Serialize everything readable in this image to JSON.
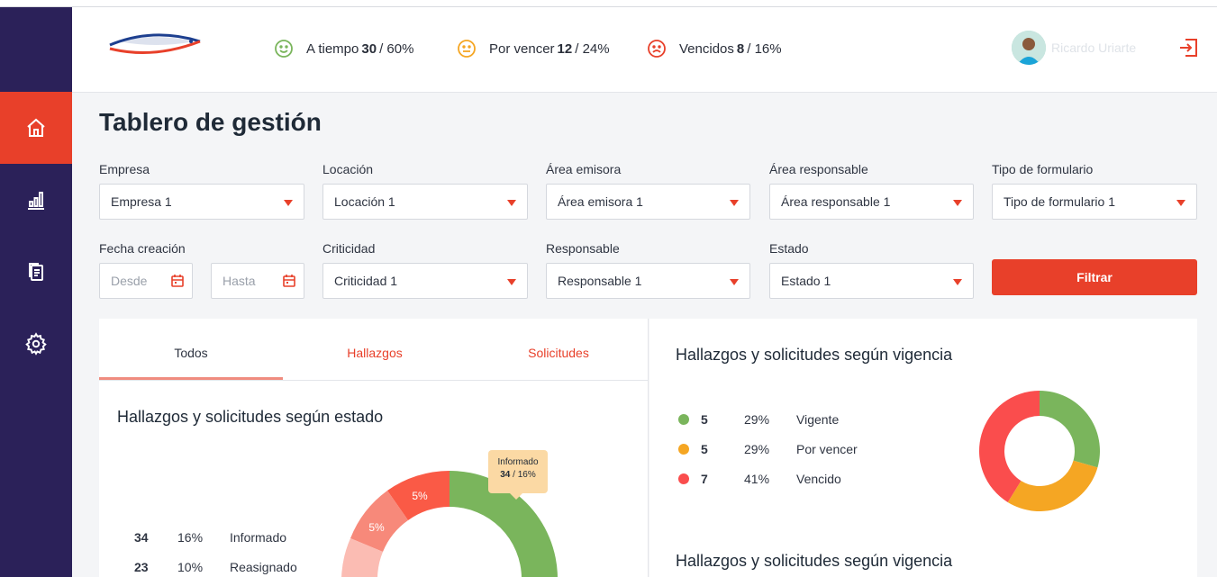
{
  "header": {
    "stats": [
      {
        "label": "A tiempo",
        "count": "30",
        "pct": "/ 60%",
        "icon": "smile-icon",
        "color": "#7ab55c"
      },
      {
        "label": "Por vencer",
        "count": "12",
        "pct": "/ 24%",
        "icon": "neutral-face-icon",
        "color": "#f5a623"
      },
      {
        "label": "Vencidos",
        "count": "8",
        "pct": "/ 16%",
        "icon": "sad-face-icon",
        "color": "#e8402a"
      }
    ],
    "user_name": "Ricardo Uriarte"
  },
  "page_title": "Tablero de gestión",
  "filters": {
    "empresa": {
      "label": "Empresa",
      "value": "Empresa 1"
    },
    "locacion": {
      "label": "Locación",
      "value": "Locación 1"
    },
    "area_emisora": {
      "label": "Área emisora",
      "value": "Área emisora 1"
    },
    "area_responsable": {
      "label": "Área responsable",
      "value": "Área responsable 1"
    },
    "tipo_formulario": {
      "label": "Tipo de formulario",
      "value": "Tipo de formulario 1"
    },
    "fecha_creacion": {
      "label": "Fecha creación",
      "desde": "Desde",
      "hasta": "Hasta"
    },
    "criticidad": {
      "label": "Criticidad",
      "value": "Criticidad 1"
    },
    "responsable": {
      "label": "Responsable",
      "value": "Responsable 1"
    },
    "estado": {
      "label": "Estado",
      "value": "Estado 1"
    },
    "button": "Filtrar"
  },
  "tabs": [
    {
      "label": "Todos",
      "active": true
    },
    {
      "label": "Hallazgos",
      "active": false
    },
    {
      "label": "Solicitudes",
      "active": false
    }
  ],
  "estado_card": {
    "title": "Hallazgos y solicitudes según estado",
    "tooltip": {
      "label": "Informado",
      "count": "34",
      "pct": "/ 16%"
    },
    "rows": [
      {
        "count": "34",
        "pct": "16%",
        "label": "Informado"
      },
      {
        "count": "23",
        "pct": "10%",
        "label": "Reasignado"
      }
    ],
    "slice_labels": [
      "5%",
      "5%"
    ]
  },
  "vigencia_card": {
    "title": "Hallazgos y solicitudes según vigencia",
    "title2": "Hallazgos y solicitudes según vigencia",
    "rows": [
      {
        "count": "5",
        "pct": "29%",
        "label": "Vigente",
        "color": "#7ab55c"
      },
      {
        "count": "5",
        "pct": "29%",
        "label": "Por vencer",
        "color": "#f5a623"
      },
      {
        "count": "7",
        "pct": "41%",
        "label": "Vencido",
        "color": "#fa4d4d"
      }
    ]
  },
  "colors": {
    "accent": "#e8402a",
    "sidebar": "#2b2159",
    "green": "#7ab55c"
  },
  "chart_data": [
    {
      "type": "pie",
      "title": "Hallazgos y solicitudes según vigencia",
      "categories": [
        "Vigente",
        "Por vencer",
        "Vencido"
      ],
      "values": [
        5,
        5,
        7
      ],
      "colors": [
        "#7ab55c",
        "#f5a623",
        "#fa4d4d"
      ]
    }
  ]
}
